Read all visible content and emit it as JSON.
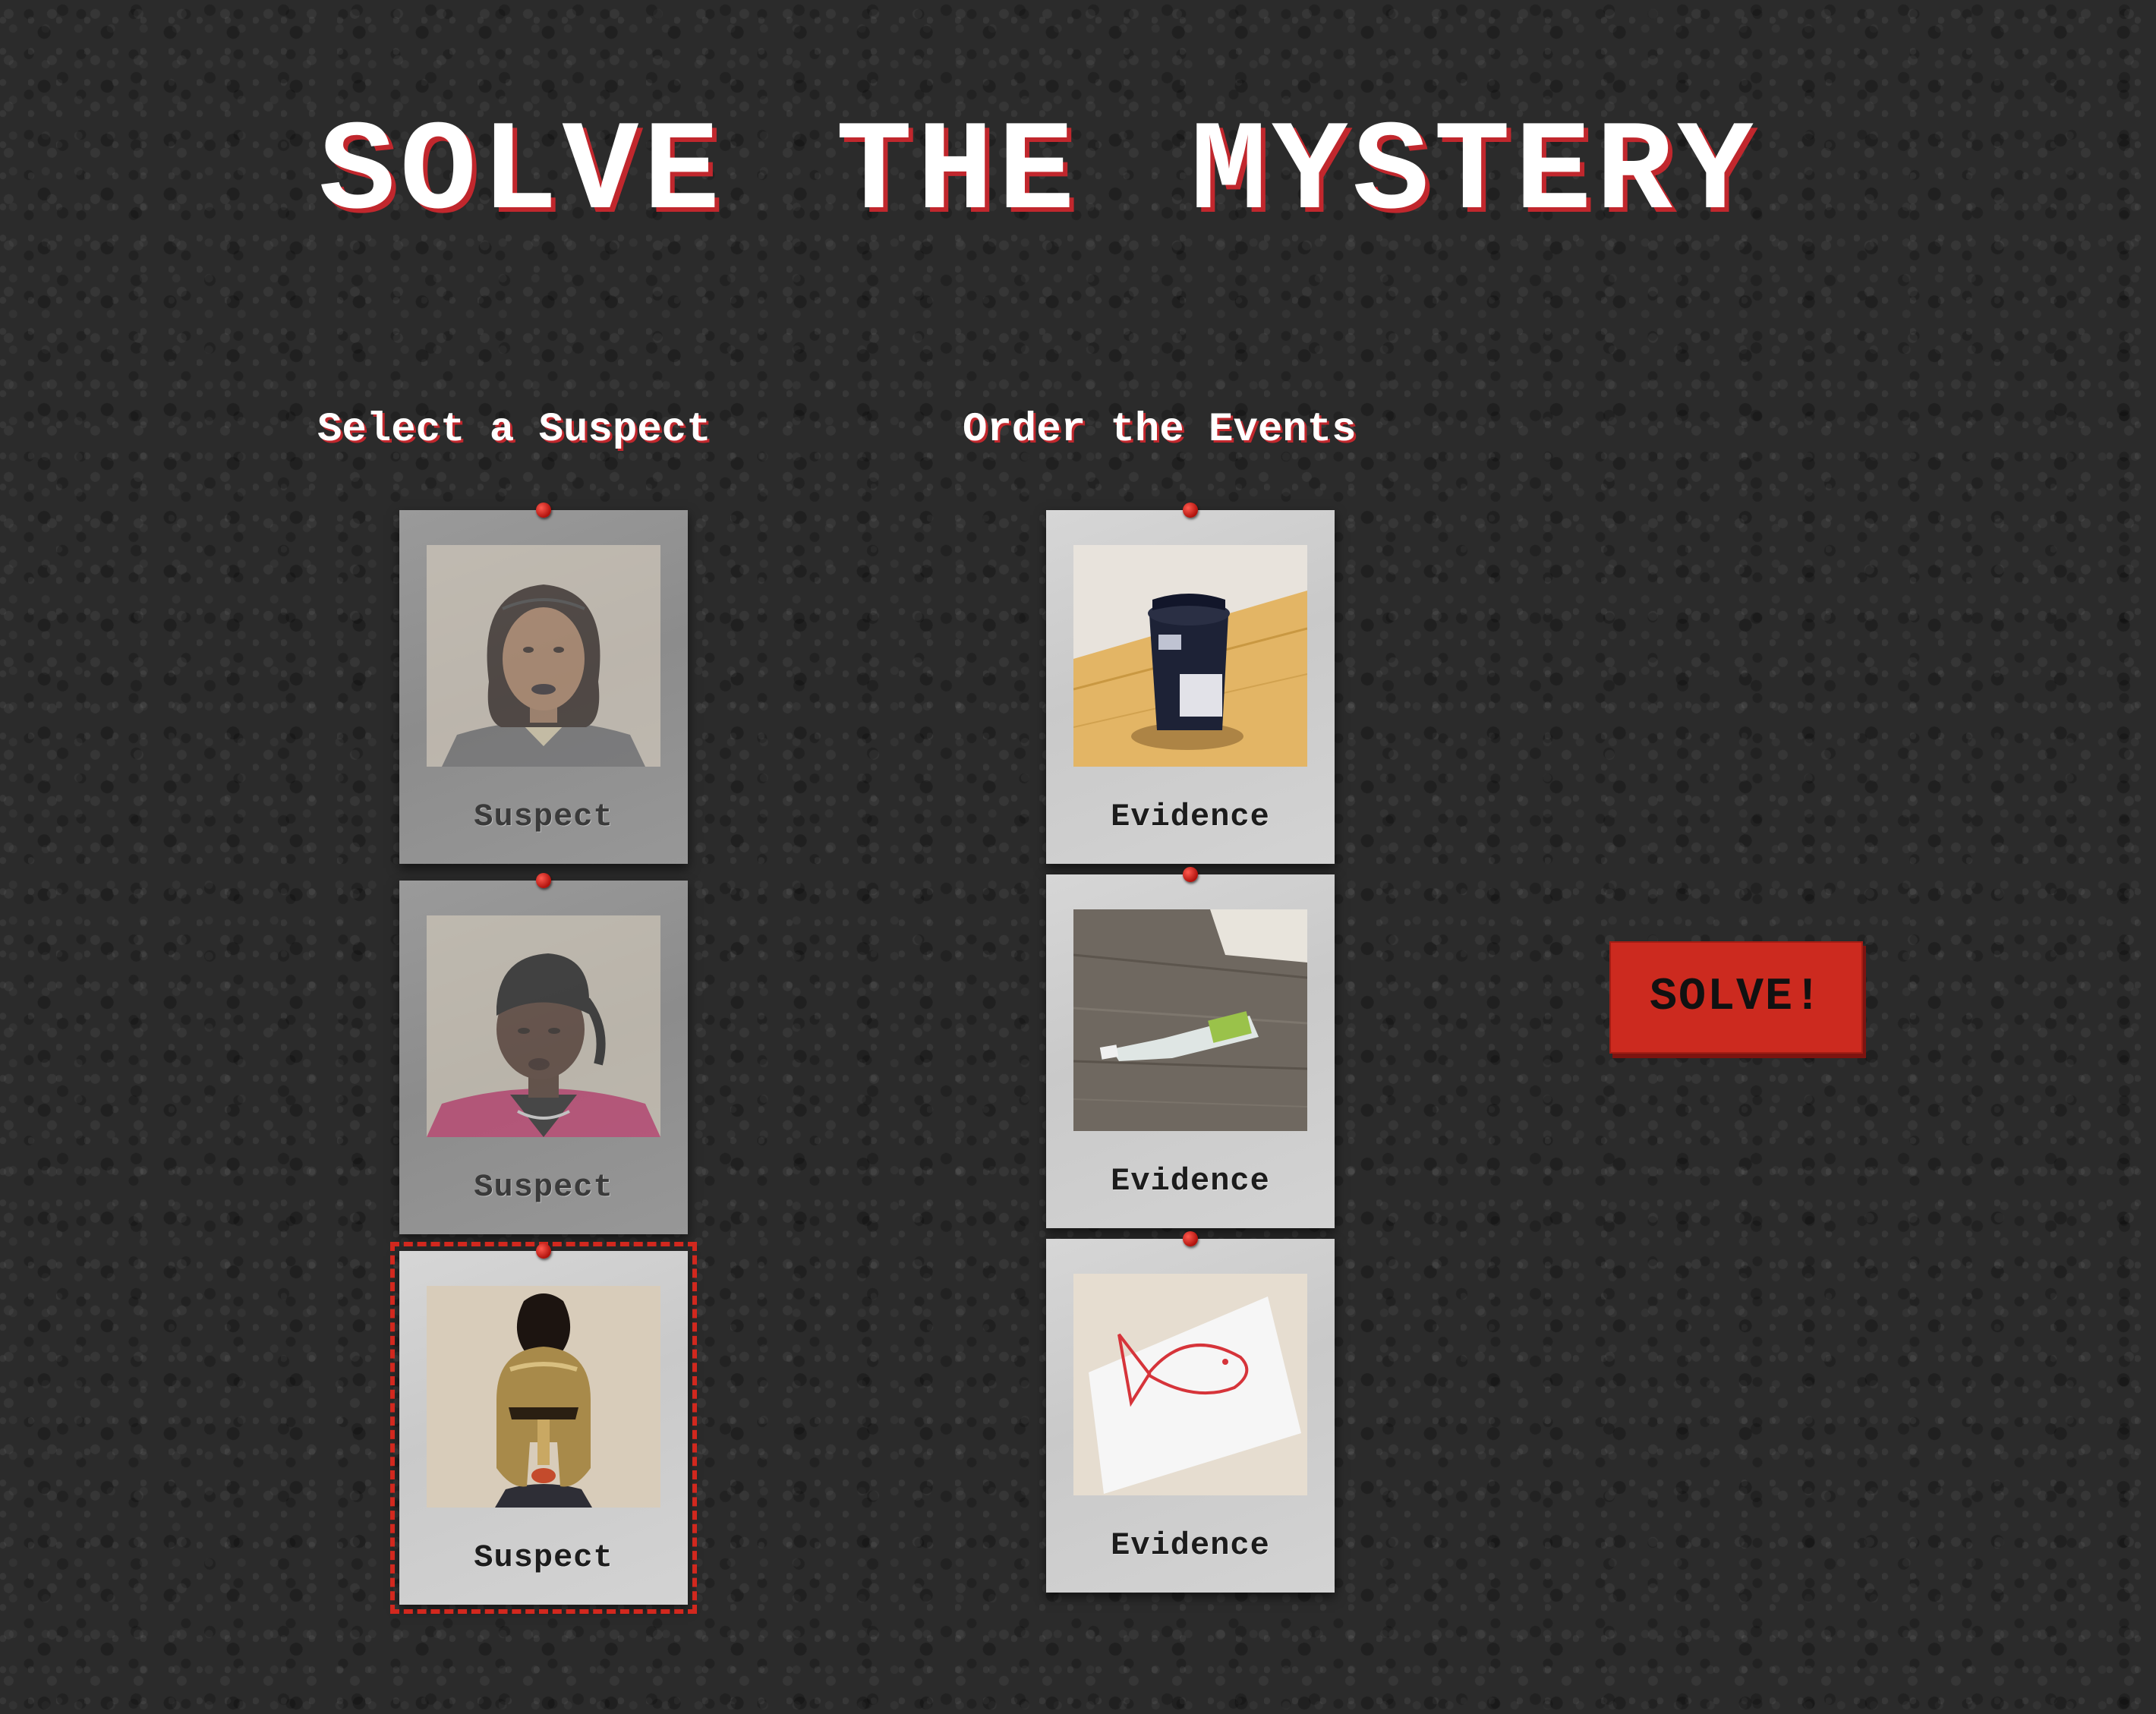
{
  "title": "SOLVE THE MYSTERY",
  "sections": {
    "suspects_heading": "Select a Suspect",
    "events_heading": "Order the Events"
  },
  "suspects": [
    {
      "label": "Suspect",
      "state": "dimmed"
    },
    {
      "label": "Suspect",
      "state": "dimmed"
    },
    {
      "label": "Suspect",
      "state": "selected"
    }
  ],
  "evidence": [
    {
      "label": "Evidence"
    },
    {
      "label": "Evidence"
    },
    {
      "label": "Evidence"
    }
  ],
  "solve_button": {
    "label": "SOLVE!"
  },
  "colors": {
    "accent_red": "#cc2a1f",
    "board": "#2b2b2b",
    "card": "#d3d3d3",
    "pin": "#c41a14"
  }
}
